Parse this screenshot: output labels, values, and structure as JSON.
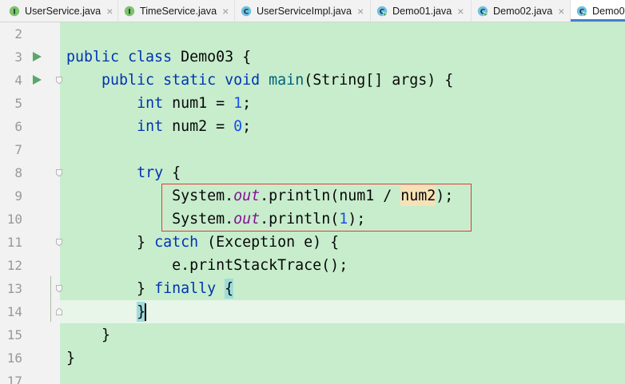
{
  "tabs": [
    {
      "label": "UserService.java",
      "icon": "interface-icon",
      "icon_letter": "I",
      "close": "×",
      "active": false
    },
    {
      "label": "TimeService.java",
      "icon": "interface-icon",
      "icon_letter": "I",
      "close": "×",
      "active": false
    },
    {
      "label": "UserServiceImpl.java",
      "icon": "class-icon",
      "icon_letter": "C",
      "close": "×",
      "active": false
    },
    {
      "label": "Demo01.java",
      "icon": "runnable-class-icon",
      "icon_letter": "C",
      "close": "×",
      "active": false
    },
    {
      "label": "Demo02.java",
      "icon": "runnable-class-icon",
      "icon_letter": "C",
      "close": "×",
      "active": false
    },
    {
      "label": "Demo0",
      "icon": "runnable-class-icon",
      "icon_letter": "C",
      "active": true
    }
  ],
  "editor": {
    "lines": [
      {
        "number": "2",
        "tokens": []
      },
      {
        "number": "3",
        "gutter_icon": "run-icon",
        "tokens": [
          {
            "text": "public class",
            "kind": "keyword"
          },
          {
            "text": " Demo03 {",
            "kind": "plain"
          }
        ]
      },
      {
        "number": "4",
        "gutter_icon": "run-icon",
        "fold": "fold-start-icon",
        "tokens": [
          {
            "text": "    ",
            "kind": "plain"
          },
          {
            "text": "public static void",
            "kind": "keyword"
          },
          {
            "text": " ",
            "kind": "plain"
          },
          {
            "text": "main",
            "kind": "method-declaration"
          },
          {
            "text": "(String[] args) {",
            "kind": "plain"
          }
        ]
      },
      {
        "number": "5",
        "tokens": [
          {
            "text": "        ",
            "kind": "plain"
          },
          {
            "text": "int",
            "kind": "keyword"
          },
          {
            "text": " num1 = ",
            "kind": "plain"
          },
          {
            "text": "1",
            "kind": "number"
          },
          {
            "text": ";",
            "kind": "plain"
          }
        ]
      },
      {
        "number": "6",
        "tokens": [
          {
            "text": "        ",
            "kind": "plain"
          },
          {
            "text": "int",
            "kind": "keyword"
          },
          {
            "text": " num2 = ",
            "kind": "plain"
          },
          {
            "text": "0",
            "kind": "number"
          },
          {
            "text": ";",
            "kind": "plain"
          }
        ]
      },
      {
        "number": "7",
        "tokens": []
      },
      {
        "number": "8",
        "fold": "fold-start-icon",
        "tokens": [
          {
            "text": "        ",
            "kind": "plain"
          },
          {
            "text": "try",
            "kind": "keyword"
          },
          {
            "text": " {",
            "kind": "plain"
          }
        ]
      },
      {
        "number": "9",
        "tokens": [
          {
            "text": "            System.",
            "kind": "plain"
          },
          {
            "text": "out",
            "kind": "static-field"
          },
          {
            "text": ".println(num1 / ",
            "kind": "plain"
          },
          {
            "text": "num2",
            "kind": "plain",
            "mark": "warning"
          },
          {
            "text": ");",
            "kind": "plain"
          }
        ]
      },
      {
        "number": "10",
        "tokens": [
          {
            "text": "            System.",
            "kind": "plain"
          },
          {
            "text": "out",
            "kind": "static-field"
          },
          {
            "text": ".println(",
            "kind": "plain"
          },
          {
            "text": "1",
            "kind": "number"
          },
          {
            "text": ");",
            "kind": "plain"
          }
        ]
      },
      {
        "number": "11",
        "fold": "fold-start-icon",
        "tokens": [
          {
            "text": "        } ",
            "kind": "plain"
          },
          {
            "text": "catch",
            "kind": "keyword"
          },
          {
            "text": " (Exception e) {",
            "kind": "plain"
          }
        ]
      },
      {
        "number": "12",
        "tokens": [
          {
            "text": "            e.printStackTrace();",
            "kind": "plain"
          }
        ]
      },
      {
        "number": "13",
        "fold": "fold-start-icon",
        "tokens": [
          {
            "text": "        } ",
            "kind": "plain"
          },
          {
            "text": "finally",
            "kind": "keyword"
          },
          {
            "text": " ",
            "kind": "plain"
          },
          {
            "text": "{",
            "kind": "plain",
            "mark": "brace-match"
          }
        ]
      },
      {
        "number": "14",
        "current": true,
        "fold": "fold-end-icon",
        "tokens": [
          {
            "text": "        ",
            "kind": "plain"
          },
          {
            "text": "}",
            "kind": "plain",
            "mark": "brace-match",
            "caret_after": true
          }
        ]
      },
      {
        "number": "15",
        "tokens": [
          {
            "text": "    }",
            "kind": "plain"
          }
        ]
      },
      {
        "number": "16",
        "tokens": [
          {
            "text": "}",
            "kind": "plain"
          }
        ]
      },
      {
        "number": "17",
        "tokens": []
      }
    ]
  },
  "colors": {
    "keyword": "#0033b3",
    "number": "#1750eb",
    "static_field": "#871094",
    "method_declaration": "#00627a",
    "plain_text": "#080808",
    "line_number": "#999999",
    "editor_background": "#c7edcc",
    "gutter_background": "#f2f2f2",
    "current_line_background": "#e8f5e9",
    "warning_highlight": "#f6e2b6",
    "brace_match_highlight": "#9fdcdc",
    "annotation_box": "#e53935",
    "run_icon": "#59a869",
    "interface_icon": "#7cc36b",
    "class_icon": "#6cc1e5",
    "active_tab_underline": "#4083c9"
  }
}
